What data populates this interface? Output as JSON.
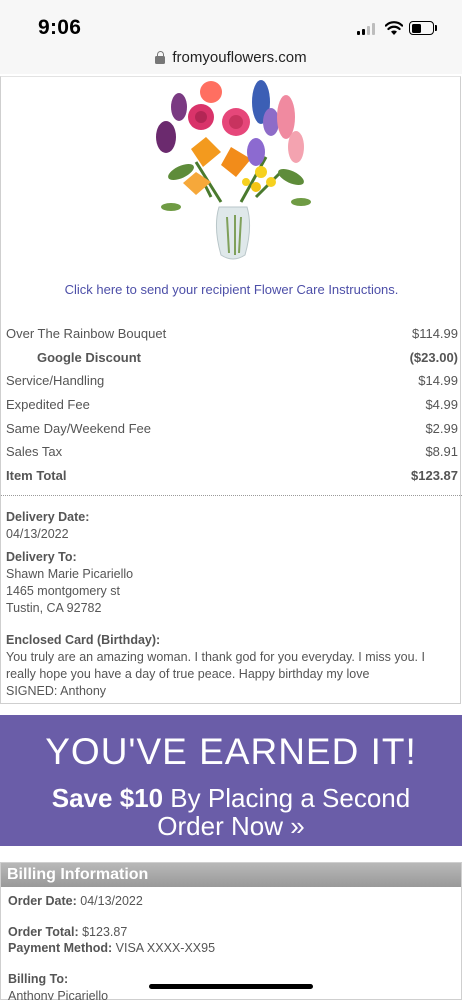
{
  "status_bar": {
    "time": "9:06"
  },
  "browser": {
    "url": "fromyouflowers.com"
  },
  "order": {
    "care_link": "Click here to send your recipient Flower Care Instructions.",
    "line_items": [
      {
        "label": "Over The Rainbow Bouquet",
        "value": "$114.99"
      },
      {
        "label": "Google Discount",
        "value": "($23.00)"
      },
      {
        "label": "Service/Handling",
        "value": "$14.99"
      },
      {
        "label": "Expedited Fee",
        "value": "$4.99"
      },
      {
        "label": "Same Day/Weekend Fee",
        "value": "$2.99"
      },
      {
        "label": "Sales Tax",
        "value": "$8.91"
      },
      {
        "label": "Item Total",
        "value": "$123.87"
      }
    ],
    "delivery_date_label": "Delivery Date:",
    "delivery_date": "04/13/2022",
    "delivery_to_label": "Delivery To:",
    "recipient_name": "Shawn Marie Picariello",
    "recipient_street": "1465 montgomery st",
    "recipient_city": "Tustin, CA 92782",
    "card_label": "Enclosed Card (Birthday):",
    "card_message": "You truly are an amazing woman. I thank god for you everyday. I miss you. I really hope you have a day of true peace. Happy birthday my love",
    "card_signed": "SIGNED: Anthony"
  },
  "promo": {
    "headline": "YOU'VE EARNED IT!",
    "save_bold": "Save $10",
    "save_rest": " By Placing a Second",
    "line3": "Order Now »",
    "background_color": "#6a5da8"
  },
  "billing": {
    "header": "Billing Information",
    "order_date_label": "Order Date:",
    "order_date": " 04/13/2022",
    "order_total_label": "Order Total:",
    "order_total": " $123.87",
    "payment_method_label": "Payment Method:",
    "payment_method": " VISA XXXX-XX95",
    "billing_to_label": "Billing To:",
    "billing_name": "Anthony Picariello"
  }
}
